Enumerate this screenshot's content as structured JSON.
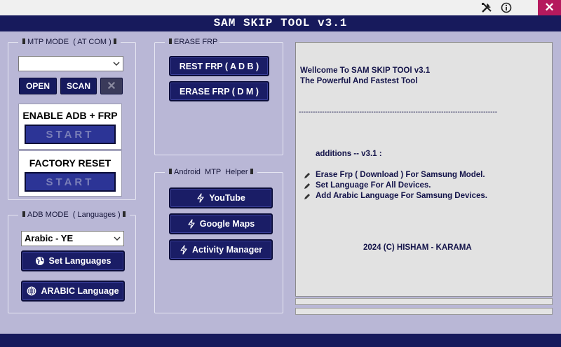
{
  "window": {
    "title": "SAM  SKIP  TOOL  v3.1"
  },
  "topbar": {
    "close_glyph": "✕"
  },
  "mtp_mode": {
    "label": "MTP MODE  ( AT COM )",
    "port_value": "",
    "open_label": "OPEN",
    "scan_label": "SCAN",
    "stop_glyph": "✕",
    "enable_adb": {
      "title": "ENABLE ADB + FRP",
      "start_label": "START"
    },
    "factory_reset": {
      "title": "FACTORY RESET",
      "start_label": "START"
    }
  },
  "adb_mode": {
    "label": "ADB MODE  ( Languages )",
    "language_value": "Arabic - YE",
    "set_languages_label": "Set Languages",
    "arabic_language_label": "ARABIC Language"
  },
  "erase_frp": {
    "label": "ERASE FRP",
    "rest_frp_label": "REST FRP  ( A D B )",
    "erase_frp_dm_label": "ERASE FRP ( D M )"
  },
  "mtp_helper": {
    "label": "Android  MTP  Helper",
    "buttons": [
      "YouTube",
      "Google Maps",
      "Activity Manager"
    ]
  },
  "log": {
    "welcome": "Wellcome To SAM SKIP TOOl v3.1",
    "tagline": "The Powerful And Fastest Tool",
    "separator": "-------------------------------------------------------------------------------------",
    "additions_title": "additions -- v3.1 :",
    "additions": [
      "Erase Frp ( Download ) For Samsung Model.",
      "Set Language For All Devices.",
      "Add Arabic Language For Samsung Devices."
    ],
    "copyright": "2024 (C) HISHAM - KARAMA"
  }
}
